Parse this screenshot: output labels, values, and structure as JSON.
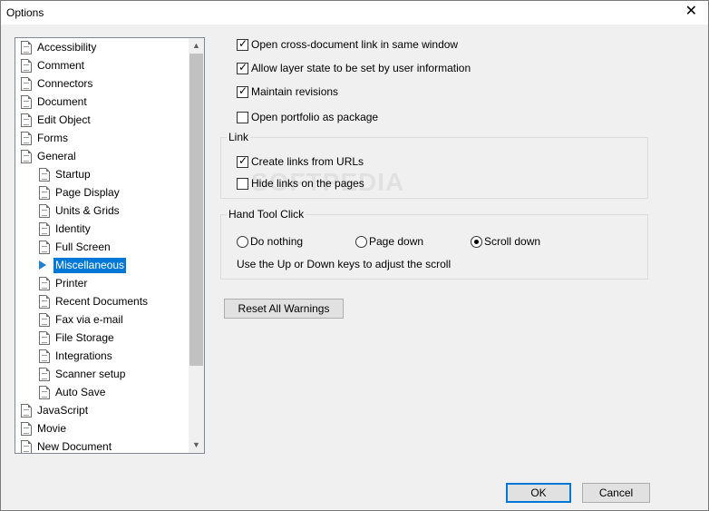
{
  "window": {
    "title": "Options"
  },
  "tree": {
    "items": [
      {
        "label": "Accessibility",
        "level": 0,
        "selected": false
      },
      {
        "label": "Comment",
        "level": 0,
        "selected": false
      },
      {
        "label": "Connectors",
        "level": 0,
        "selected": false
      },
      {
        "label": "Document",
        "level": 0,
        "selected": false
      },
      {
        "label": "Edit Object",
        "level": 0,
        "selected": false
      },
      {
        "label": "Forms",
        "level": 0,
        "selected": false
      },
      {
        "label": "General",
        "level": 0,
        "selected": false
      },
      {
        "label": "Startup",
        "level": 1,
        "selected": false
      },
      {
        "label": "Page Display",
        "level": 1,
        "selected": false
      },
      {
        "label": "Units & Grids",
        "level": 1,
        "selected": false
      },
      {
        "label": "Identity",
        "level": 1,
        "selected": false
      },
      {
        "label": "Full Screen",
        "level": 1,
        "selected": false
      },
      {
        "label": "Miscellaneous",
        "level": 1,
        "selected": true
      },
      {
        "label": "Printer",
        "level": 1,
        "selected": false
      },
      {
        "label": "Recent Documents",
        "level": 1,
        "selected": false
      },
      {
        "label": "Fax via e-mail",
        "level": 1,
        "selected": false
      },
      {
        "label": "File Storage",
        "level": 1,
        "selected": false
      },
      {
        "label": "Integrations",
        "level": 1,
        "selected": false
      },
      {
        "label": "Scanner setup",
        "level": 1,
        "selected": false
      },
      {
        "label": "Auto Save",
        "level": 1,
        "selected": false
      },
      {
        "label": "JavaScript",
        "level": 0,
        "selected": false
      },
      {
        "label": "Movie",
        "level": 0,
        "selected": false
      },
      {
        "label": "New Document",
        "level": 0,
        "selected": false
      }
    ]
  },
  "options": {
    "cross_doc_link": {
      "label": "Open cross-document link in same window",
      "checked": true
    },
    "layer_state": {
      "label": "Allow layer state to be set by user information",
      "checked": true
    },
    "maintain_revisions": {
      "label": "Maintain revisions",
      "checked": true
    },
    "portfolio_package": {
      "label": "Open portfolio as package",
      "checked": false
    }
  },
  "link_group": {
    "title": "Link",
    "create_links": {
      "label": "Create links from URLs",
      "checked": true
    },
    "hide_links": {
      "label": "Hide links on the pages",
      "checked": false
    }
  },
  "hand_tool": {
    "title": "Hand Tool Click",
    "options": [
      {
        "label": "Do nothing",
        "selected": false
      },
      {
        "label": "Page down",
        "selected": false
      },
      {
        "label": "Scroll down",
        "selected": true
      }
    ],
    "hint": "Use the Up or Down keys to adjust the scroll"
  },
  "buttons": {
    "reset_warnings": "Reset All Warnings",
    "ok": "OK",
    "cancel": "Cancel"
  },
  "watermark": "SOFTPEDIA",
  "icons": {
    "close": "close-icon",
    "tree_item": "document-icon",
    "selected_marker": "triangle-right-icon",
    "scroll_up": "chevron-up-icon",
    "scroll_down": "chevron-down-icon"
  }
}
